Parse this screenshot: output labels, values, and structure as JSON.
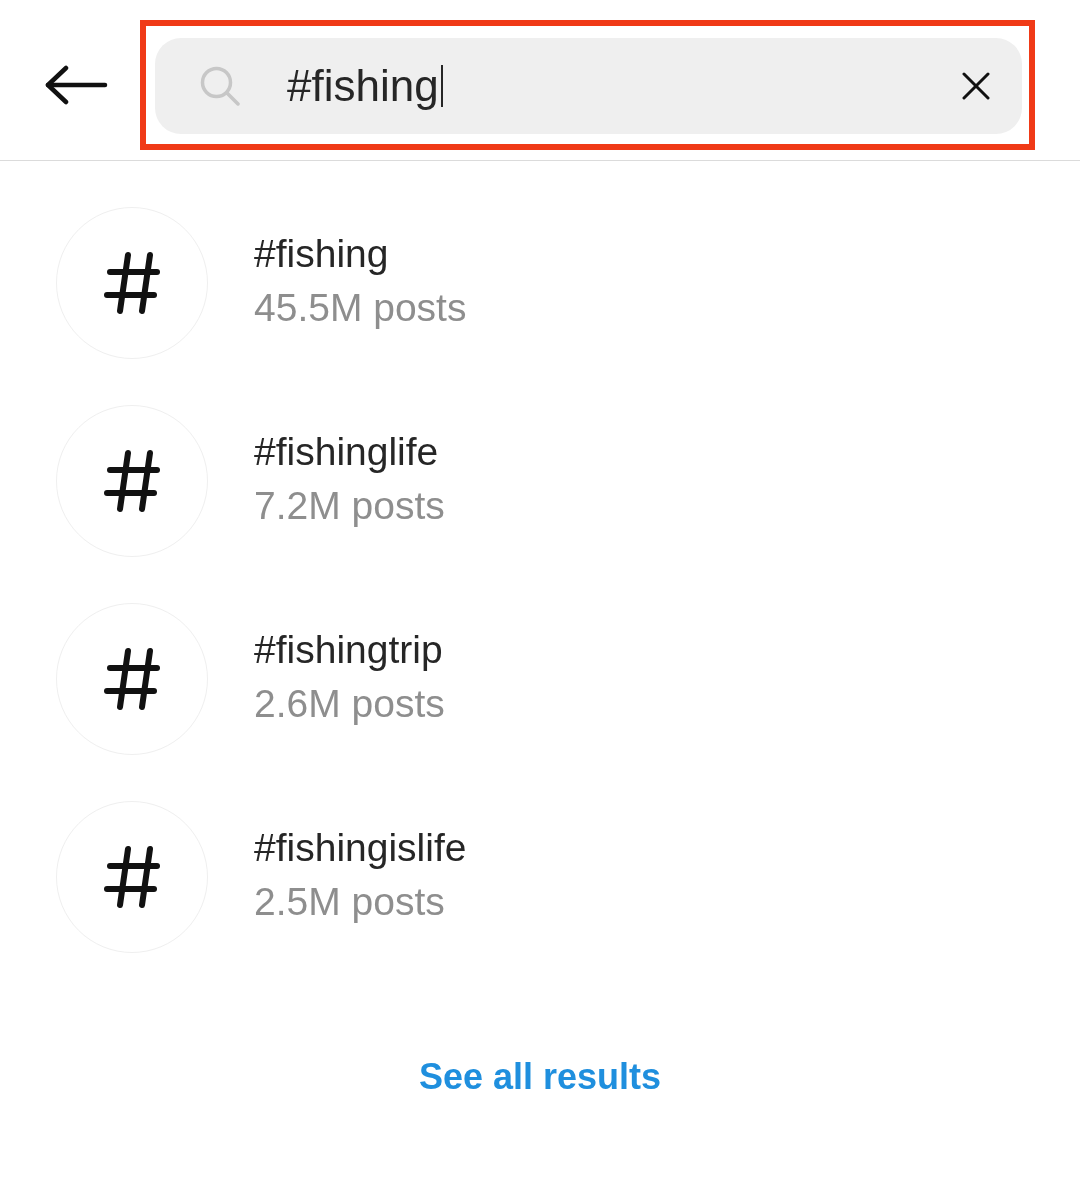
{
  "search": {
    "value": "#fishing",
    "focused": true,
    "highlighted": true
  },
  "results": [
    {
      "tag": "#fishing",
      "count": "45.5M posts"
    },
    {
      "tag": "#fishinglife",
      "count": "7.2M posts"
    },
    {
      "tag": "#fishingtrip",
      "count": "2.6M posts"
    },
    {
      "tag": "#fishingislife",
      "count": "2.5M posts"
    }
  ],
  "see_all": "See all results"
}
